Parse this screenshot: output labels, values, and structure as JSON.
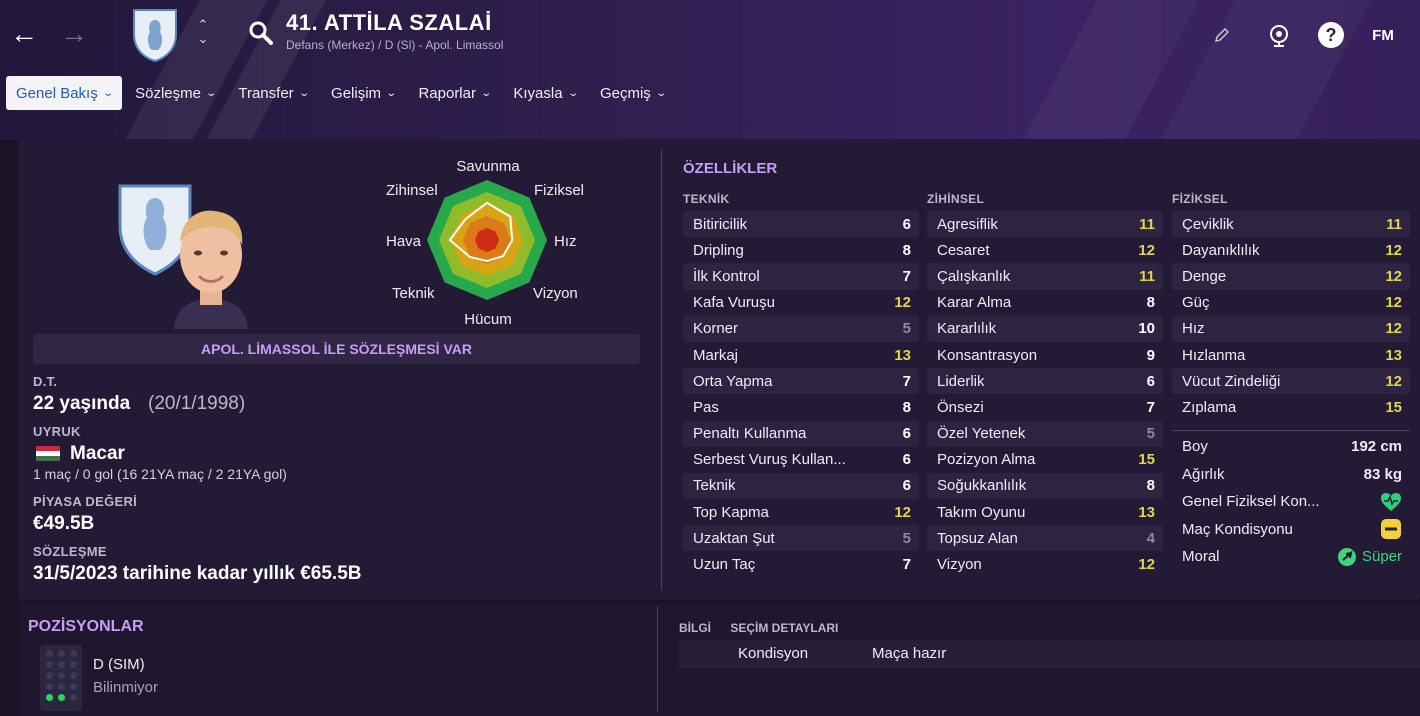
{
  "header": {
    "player_name": "41. ATTİLA SZALAİ",
    "subtitle": "Defans (Merkez) / D (Sl) - Apol. Limassol",
    "fm_label": "FM"
  },
  "tabs": [
    {
      "label": "Genel Bakış",
      "active": true
    },
    {
      "label": "Sözleşme"
    },
    {
      "label": "Transfer"
    },
    {
      "label": "Gelişim"
    },
    {
      "label": "Raporlar"
    },
    {
      "label": "Kıyasla"
    },
    {
      "label": "Geçmiş"
    }
  ],
  "radar": {
    "labels": {
      "top": "Savunma",
      "top_right": "Fiziksel",
      "right": "Hız",
      "bottom_right": "Vizyon",
      "bottom": "Hücum",
      "bottom_left": "Teknik",
      "left": "Hava",
      "top_left": "Zihinsel"
    }
  },
  "contract_banner": "APOL. LİMASSOL İLE SÖZLEŞMESİ VAR",
  "info": {
    "dob_label": "D.T.",
    "age": "22 yaşında",
    "dob": "(20/1/1998)",
    "nationality_label": "UYRUK",
    "nationality": "Macar",
    "caps": "1 maç / 0 gol (16 21YA maç / 2 21YA gol)",
    "value_label": "PİYASA DEĞERİ",
    "value": "€49.5B",
    "contract_label": "SÖZLEŞME",
    "contract": "31/5/2023 tarihine kadar yıllık €65.5B"
  },
  "attributes": {
    "title": "ÖZELLİKLER",
    "technical_title": "TEKNİK",
    "mental_title": "ZİHİNSEL",
    "physical_title": "FİZİKSEL",
    "technical": [
      {
        "name": "Bitiricilik",
        "value": "6",
        "tone": "white"
      },
      {
        "name": "Dripling",
        "value": "8",
        "tone": "white"
      },
      {
        "name": "İlk Kontrol",
        "value": "7",
        "tone": "white"
      },
      {
        "name": "Kafa Vuruşu",
        "value": "12",
        "tone": "yellow"
      },
      {
        "name": "Korner",
        "value": "5",
        "tone": "grey"
      },
      {
        "name": "Markaj",
        "value": "13",
        "tone": "yellow"
      },
      {
        "name": "Orta Yapma",
        "value": "7",
        "tone": "white"
      },
      {
        "name": "Pas",
        "value": "8",
        "tone": "white"
      },
      {
        "name": "Penaltı Kullanma",
        "value": "6",
        "tone": "white"
      },
      {
        "name": "Serbest Vuruş Kullan...",
        "value": "6",
        "tone": "white"
      },
      {
        "name": "Teknik",
        "value": "6",
        "tone": "white"
      },
      {
        "name": "Top Kapma",
        "value": "12",
        "tone": "yellow"
      },
      {
        "name": "Uzaktan Şut",
        "value": "5",
        "tone": "grey"
      },
      {
        "name": "Uzun Taç",
        "value": "7",
        "tone": "white"
      }
    ],
    "mental": [
      {
        "name": "Agresiflik",
        "value": "11",
        "tone": "yellow"
      },
      {
        "name": "Cesaret",
        "value": "12",
        "tone": "yellow"
      },
      {
        "name": "Çalışkanlık",
        "value": "11",
        "tone": "yellow"
      },
      {
        "name": "Karar Alma",
        "value": "8",
        "tone": "white"
      },
      {
        "name": "Kararlılık",
        "value": "10",
        "tone": "white"
      },
      {
        "name": "Konsantrasyon",
        "value": "9",
        "tone": "white"
      },
      {
        "name": "Liderlik",
        "value": "6",
        "tone": "white"
      },
      {
        "name": "Önsezi",
        "value": "7",
        "tone": "white"
      },
      {
        "name": "Özel Yetenek",
        "value": "5",
        "tone": "grey"
      },
      {
        "name": "Pozizyon Alma",
        "value": "15",
        "tone": "yellow"
      },
      {
        "name": "Soğukkanlılık",
        "value": "8",
        "tone": "white"
      },
      {
        "name": "Takım Oyunu",
        "value": "13",
        "tone": "yellow"
      },
      {
        "name": "Topsuz Alan",
        "value": "4",
        "tone": "grey"
      },
      {
        "name": "Vizyon",
        "value": "12",
        "tone": "yellow"
      }
    ],
    "physical": [
      {
        "name": "Çeviklik",
        "value": "11",
        "tone": "yellow"
      },
      {
        "name": "Dayanıklılık",
        "value": "12",
        "tone": "yellow"
      },
      {
        "name": "Denge",
        "value": "12",
        "tone": "yellow"
      },
      {
        "name": "Güç",
        "value": "12",
        "tone": "yellow"
      },
      {
        "name": "Hız",
        "value": "12",
        "tone": "yellow"
      },
      {
        "name": "Hızlanma",
        "value": "13",
        "tone": "yellow"
      },
      {
        "name": "Vücut Zindeliği",
        "value": "12",
        "tone": "yellow"
      },
      {
        "name": "Zıplama",
        "value": "15",
        "tone": "yellow"
      }
    ],
    "extra": {
      "height_label": "Boy",
      "height": "192 cm",
      "weight_label": "Ağırlık",
      "weight": "83 kg",
      "fitness_label": "Genel Fiziksel Kon...",
      "fitness_icon": "heart-icon",
      "match_fitness_label": "Maç Kondisyonu",
      "match_fitness_icon": "minus-badge-icon",
      "morale_label": "Moral",
      "morale": "Süper"
    }
  },
  "positions": {
    "title": "POZİSYONLAR",
    "position": "D (SIM)",
    "status": "Bilinmiyor"
  },
  "selection": {
    "tab_info": "BİLGİ",
    "tab_details": "SEÇİM DETAYLARI",
    "label": "Kondisyon",
    "value": "Maça hazır"
  },
  "colors": {
    "accent": "#c99cf5",
    "good": "#e3d44d",
    "bg": "#1b1429",
    "panel": "#231b35"
  }
}
